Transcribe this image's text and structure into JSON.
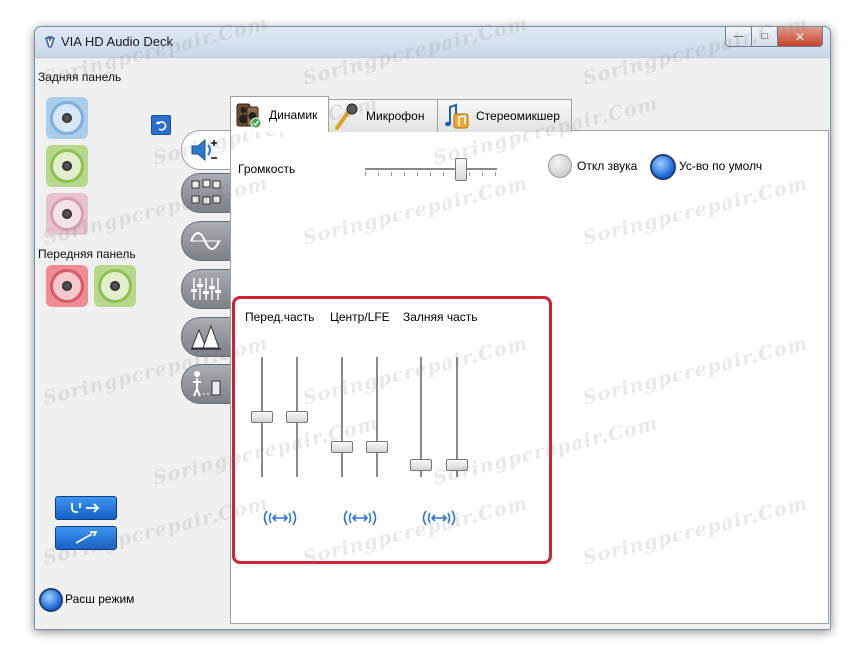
{
  "window": {
    "title": "VIA HD Audio Deck",
    "controls": {
      "minimize": "—",
      "maximize": "□",
      "close": "✕"
    }
  },
  "sidebar": {
    "rear_label": "Задняя панель",
    "front_label": "Передняя панель",
    "rear_jacks": [
      {
        "icon": "audio-jack-blue-icon",
        "color": "#a9cdea"
      },
      {
        "icon": "audio-jack-green-icon",
        "color": "#b7d88b"
      },
      {
        "icon": "audio-jack-pink-icon",
        "color": "#e8c2cf"
      }
    ],
    "front_jacks": [
      {
        "icon": "audio-jack-pink-icon",
        "color": "#ef8c95"
      },
      {
        "icon": "audio-jack-green-icon",
        "color": "#b7d88b"
      }
    ],
    "advanced_mode_label": "Расш режим"
  },
  "vertical_tabs": [
    {
      "icon": "speaker-volume-icon",
      "active": true
    },
    {
      "icon": "speaker-configuration-icon",
      "active": false
    },
    {
      "icon": "sine-wave-icon",
      "active": false
    },
    {
      "icon": "equalizer-icon",
      "active": false
    },
    {
      "icon": "environment-icon",
      "active": false
    },
    {
      "icon": "room-correction-icon",
      "active": false
    }
  ],
  "tabs": [
    {
      "label": "Динамик",
      "icon": "speaker-icon",
      "active": true
    },
    {
      "label": "Микрофон",
      "icon": "microphone-icon",
      "active": false
    },
    {
      "label": "Стереомикшер",
      "icon": "music-notes-icon",
      "active": false
    }
  ],
  "volume": {
    "label": "Громкость",
    "level": 0.73,
    "mute_label": "Откл звука",
    "default_device_label": "Ус-во по умолч"
  },
  "channels": {
    "front_label": "Перед.часть",
    "center_label": "Центр/LFE",
    "rear_label": "Залняя часть",
    "levels": [
      0.5,
      0.5,
      0.25,
      0.25,
      0.1,
      0.1
    ]
  },
  "colors": {
    "accent_blue": "#1565d8",
    "highlight_red": "#d0233a"
  },
  "watermark": "Soringpcrepair.Com"
}
